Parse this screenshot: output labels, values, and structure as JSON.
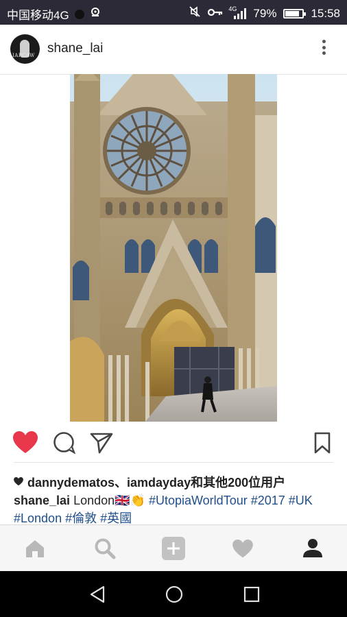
{
  "status_bar": {
    "carrier": "中国移动4G",
    "network_label": "4G",
    "battery": "79%",
    "time": "15:58"
  },
  "post": {
    "username": "shane_lai",
    "avatar_text": "IAPCAW",
    "likes_text": "dannydematos、iamdayday和其他200位用户",
    "caption": {
      "user": "shane_lai",
      "text": "London🇬🇧👏",
      "hashtags_line1": "#UtopiaWorldTour #2017 #UK",
      "hashtags_line2": "#London #倫敦 #英國"
    }
  },
  "icons": {
    "like": "heart-icon",
    "comment": "comment-icon",
    "share": "send-icon",
    "save": "bookmark-icon",
    "more": "more-vertical-icon"
  },
  "bottom_nav": [
    "home-icon",
    "search-icon",
    "add-icon",
    "activity-icon",
    "profile-icon"
  ],
  "colors": {
    "like_red": "#e8374a",
    "hashtag_blue": "#1f4f8b",
    "status_bar_bg": "#2c2a36"
  }
}
